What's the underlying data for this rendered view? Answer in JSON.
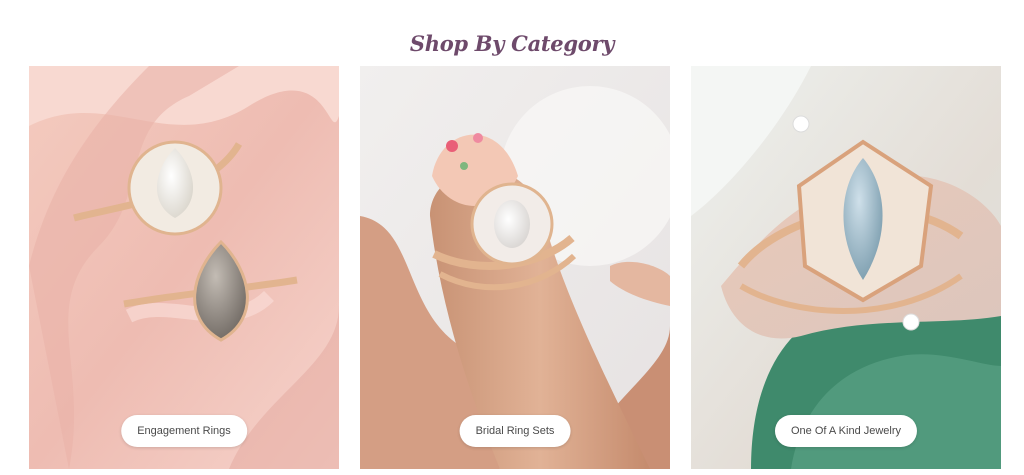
{
  "section": {
    "title": "Shop By Category"
  },
  "categories": [
    {
      "label": "Engagement Rings"
    },
    {
      "label": "Bridal Ring Sets"
    },
    {
      "label": "One Of A Kind Jewelry"
    }
  ]
}
